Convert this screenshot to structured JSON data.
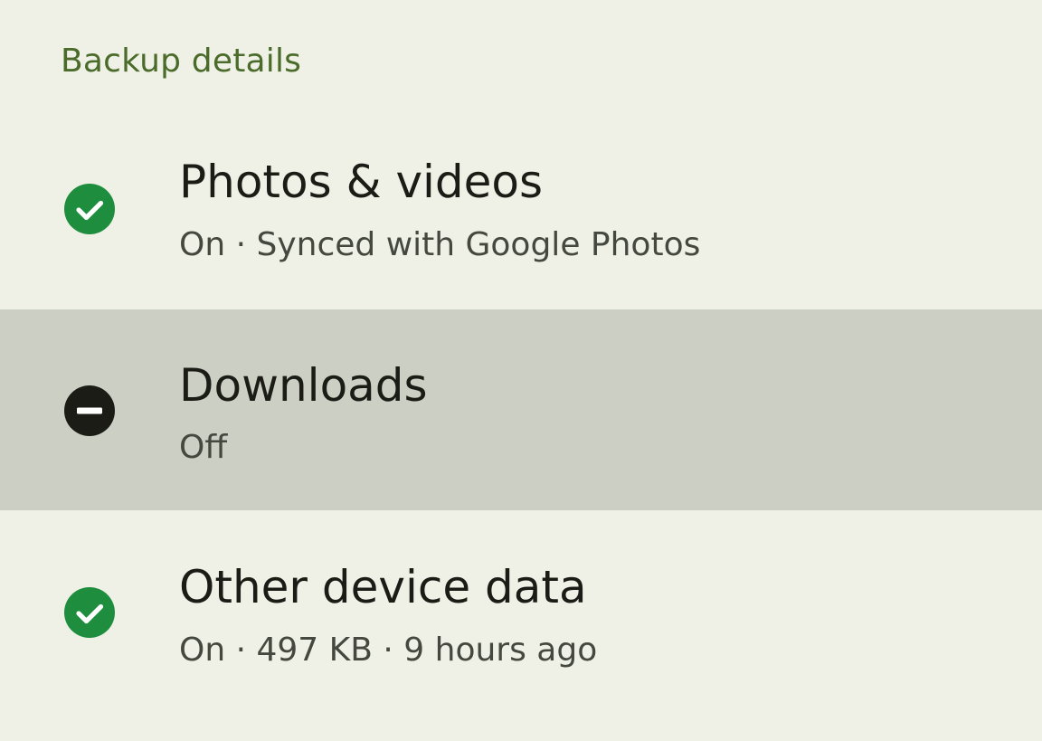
{
  "section": {
    "header": "Backup details"
  },
  "items": [
    {
      "title": "Photos & videos",
      "subtitle": "On · Synced with Google Photos",
      "status": "on",
      "icon": "check-circle-icon",
      "icon_color": "#1e8e3e"
    },
    {
      "title": "Downloads",
      "subtitle": "Off",
      "status": "off",
      "icon": "minus-circle-icon",
      "icon_color": "#1c1c17"
    },
    {
      "title": "Other device data",
      "subtitle": "On · 497 KB · 9 hours ago",
      "status": "on",
      "icon": "check-circle-icon",
      "icon_color": "#1e8e3e"
    }
  ],
  "colors": {
    "background": "#eff1e6",
    "highlight_row": "#cccfc3",
    "header_text": "#4b6b2a",
    "status_on": "#1e8e3e",
    "status_off": "#1c1c17"
  }
}
